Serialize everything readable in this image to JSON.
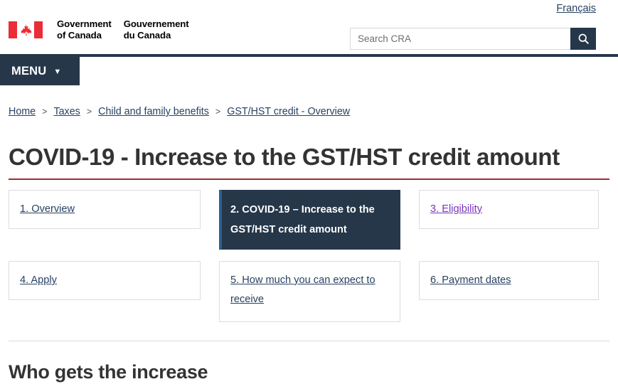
{
  "header": {
    "language_toggle": "Français",
    "wordmark_en": [
      "Government",
      "of Canada"
    ],
    "wordmark_fr": [
      "Gouvernement",
      "du Canada"
    ],
    "flag_color": "#EA2D37",
    "search": {
      "placeholder": "Search CRA",
      "value": "",
      "button_icon": "search-icon"
    },
    "menu": {
      "label": "MENU",
      "caret_icon": "chevron-down-icon"
    },
    "brand_color": "#26374A"
  },
  "breadcrumb": {
    "separator": ">",
    "items": [
      {
        "label": "Home"
      },
      {
        "label": "Taxes"
      },
      {
        "label": "Child and family benefits"
      },
      {
        "label": "GST/HST credit - Overview"
      }
    ]
  },
  "main": {
    "page_title": "COVID-19 - Increase to the GST/HST credit amount",
    "title_rule_color": "#9A3032",
    "tiles": [
      {
        "label": "1. Overview",
        "state": "link"
      },
      {
        "label": "2. COVID-19 – Increase to the GST/HST credit amount",
        "state": "active"
      },
      {
        "label": "3. Eligibility",
        "state": "visited"
      },
      {
        "label": "4. Apply",
        "state": "link"
      },
      {
        "label": "5. How much you can expect to receive",
        "state": "link"
      },
      {
        "label": "6. Payment dates",
        "state": "link"
      }
    ],
    "section_title": "Who gets the increase"
  }
}
